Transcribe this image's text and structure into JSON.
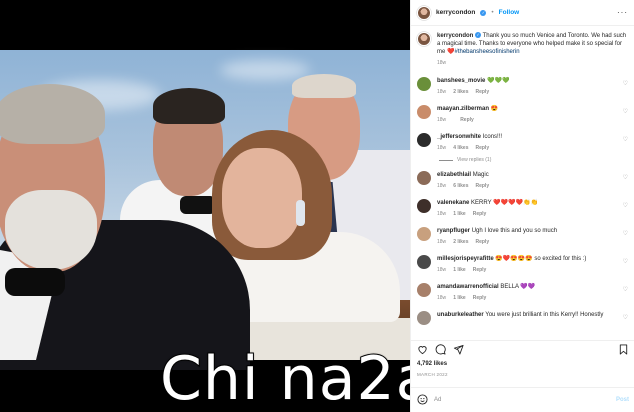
{
  "header": {
    "username": "kerrycondon",
    "follow_label": "Follow",
    "separator": "•",
    "more_glyph": "···"
  },
  "caption": {
    "username": "kerrycondon",
    "text": "Thank you so much Venice and Toronto. We had such a magical time. Thanks to everyone who helped make it so special for me",
    "hashtag": "❤️#thebansheesofinisherin",
    "time": "18w"
  },
  "comments": [
    {
      "username": "banshees_movie",
      "text": "💚💚💚",
      "time": "18w",
      "likes": "2 likes",
      "reply": "Reply",
      "avatar": "av-banshees"
    },
    {
      "username": "maayan.zilberman",
      "text": "😍",
      "time": "18w",
      "likes": "",
      "reply": "Reply",
      "avatar": "av-maayan"
    },
    {
      "username": "_jeffersonwhite",
      "text": "Icons!!!",
      "time": "18w",
      "likes": "4 likes",
      "reply": "Reply",
      "avatar": "av-jefferson",
      "view_replies": "View replies (1)"
    },
    {
      "username": "elizabethlail",
      "text": "Magic",
      "time": "18w",
      "likes": "6 likes",
      "reply": "Reply",
      "avatar": "av-elizabeth"
    },
    {
      "username": "valenekane",
      "text": "KERRY ❤️❤️❤️❤️👏👏",
      "time": "18w",
      "likes": "1 like",
      "reply": "Reply",
      "avatar": "av-valene"
    },
    {
      "username": "ryanpfluger",
      "text": "Ugh I love this and you so much",
      "time": "18w",
      "likes": "2 likes",
      "reply": "Reply",
      "avatar": "av-ryan"
    },
    {
      "username": "millesjorispeyrafitte",
      "text": "😍❤️😍😍😍 so excited for this :)",
      "time": "18w",
      "likes": "1 like",
      "reply": "Reply",
      "avatar": "av-milles"
    },
    {
      "username": "amandawarrenofficial",
      "text": "BELLA 💜💜",
      "time": "18w",
      "likes": "1 like",
      "reply": "Reply",
      "avatar": "av-amanda"
    },
    {
      "username": "unaburkeleather",
      "text": "You were just brilliant in this Kerry!! Honestly",
      "time": "",
      "likes": "",
      "reply": "",
      "avatar": "av-una"
    }
  ],
  "stats": {
    "likes": "4,792 likes",
    "date": "MARCH  2022"
  },
  "add_comment": {
    "placeholder": "Ad",
    "post_label": "Post"
  },
  "watermark": {
    "text": "Chi na2a"
  },
  "icons": {
    "like": "heart-icon",
    "comment": "comment-icon",
    "share": "share-icon",
    "save": "bookmark-icon",
    "emoji": "emoji-icon"
  },
  "colors": {
    "link": "#0095f6",
    "hashtag": "#00376b",
    "muted": "#8e8e8e",
    "verified": "#3897f0"
  }
}
